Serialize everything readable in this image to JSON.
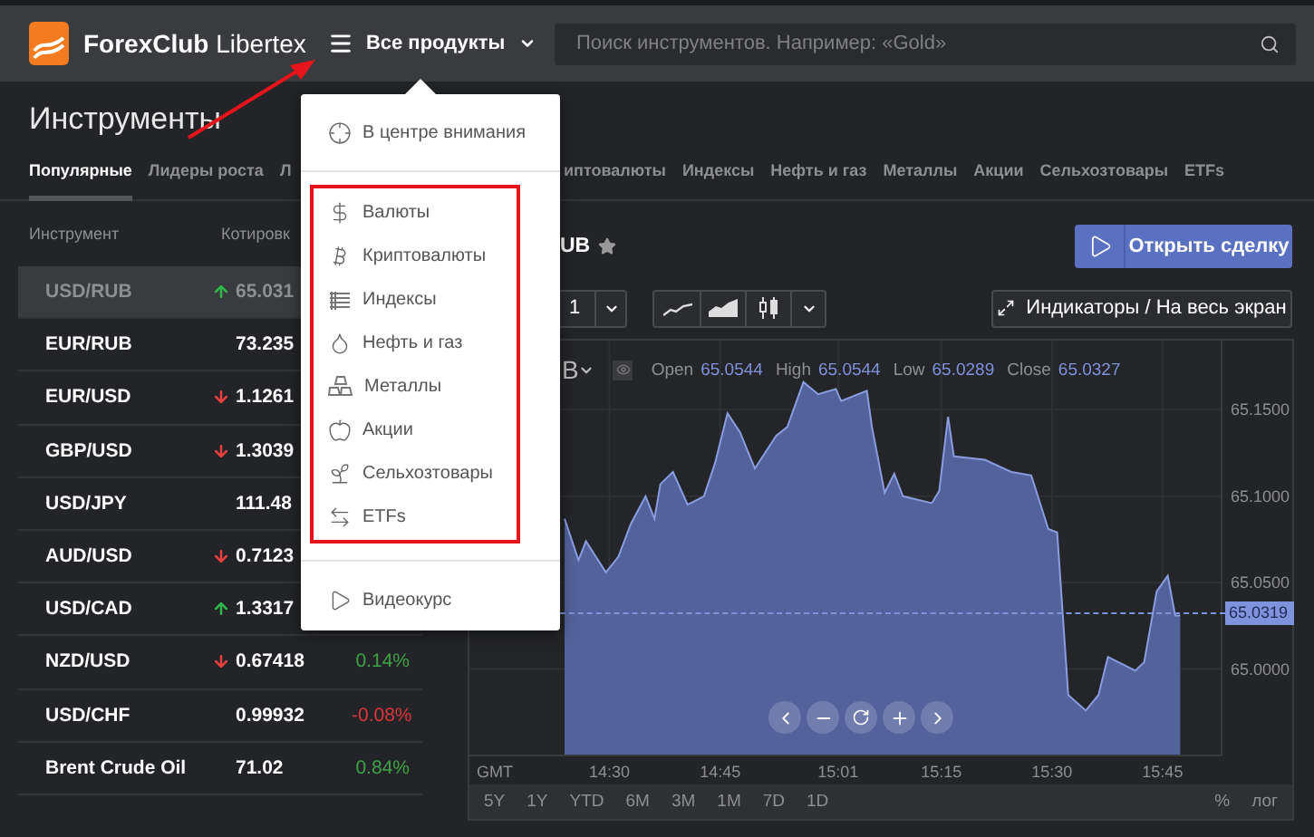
{
  "header": {
    "logo_text": "**ForexClub** Libertex",
    "menu_label": "Все продукты",
    "search": {
      "placeholder": "Поиск инструментов. Например: «Gold»"
    }
  },
  "page_title": "Инструменты",
  "tabs": {
    "before_menu": [
      {
        "label": "Популярные",
        "selected": true
      },
      {
        "label": "Лидеры роста",
        "selected": false
      },
      {
        "label": "Л",
        "selected": false
      }
    ],
    "after_menu": [
      {
        "label": "иптовалюты",
        "selected": false
      },
      {
        "label": "Индексы",
        "selected": false
      },
      {
        "label": "Нефть и газ",
        "selected": false
      },
      {
        "label": "Металлы",
        "selected": false
      },
      {
        "label": "Акции",
        "selected": false
      },
      {
        "label": "Сельхозтовары",
        "selected": false
      },
      {
        "label": "ETFs",
        "selected": false
      }
    ]
  },
  "instruments": {
    "columns": [
      "Инструмент",
      "Котировк"
    ],
    "rows": [
      {
        "name": "USD/RUB",
        "arrow_up": true,
        "quote": "65.031",
        "selected": true
      },
      {
        "name": "EUR/RUB",
        "quote": "73.235",
        "selected": false
      },
      {
        "name": "EUR/USD",
        "arrow_up": false,
        "quote": "1.1261",
        "selected": false
      },
      {
        "name": "GBP/USD",
        "arrow_up": false,
        "quote": "1.3039",
        "selected": false
      },
      {
        "name": "USD/JPY",
        "quote": "111.48",
        "selected": false
      },
      {
        "name": "AUD/USD",
        "arrow_up": false,
        "quote": "0.7123",
        "selected": false
      },
      {
        "name": "USD/CAD",
        "arrow_up": true,
        "quote": "1.3317",
        "selected": false
      },
      {
        "name": "NZD/USD",
        "arrow_up": false,
        "quote": "0.67418",
        "change": "0.14%",
        "change_positive": true,
        "selected": false
      },
      {
        "name": "USD/CHF",
        "quote": "0.99932",
        "change": "-0.08%",
        "change_positive": false,
        "selected": false
      },
      {
        "name": "Brent Crude Oil",
        "quote": "71.02",
        "change": "0.84%",
        "change_positive": true,
        "selected": false
      }
    ]
  },
  "chart_panel": {
    "symbol": "UB",
    "open_trade_button": "Открыть сделку",
    "interval": "1",
    "chart_types": [
      {
        "kind": "line"
      },
      {
        "kind": "area"
      },
      {
        "kind": "candles"
      }
    ],
    "indicators_button": "Индикаторы / На весь экран",
    "legend": {
      "symbol": "B",
      "items": [
        {
          "label": "Open",
          "value": "65.0544"
        },
        {
          "label": "High",
          "value": "65.0544"
        },
        {
          "label": "Low",
          "value": "65.0289"
        },
        {
          "label": "Close",
          "value": "65.0327"
        }
      ]
    },
    "last_price": "65.0319",
    "timezone": "GMT",
    "ranges": [
      "5Y",
      "1Y",
      "YTD",
      "6M",
      "3M",
      "1M",
      "7D",
      "1D"
    ],
    "scale_options": [
      "%",
      "лог"
    ],
    "chart_data": {
      "type": "area",
      "grid": true,
      "xlim": [
        851,
        953
      ],
      "ylim": [
        64.95,
        65.19
      ],
      "xticks": [
        {
          "value": 870,
          "label": "14:30"
        },
        {
          "value": 885,
          "label": "14:45"
        },
        {
          "value": 901,
          "label": "15:01"
        },
        {
          "value": 915,
          "label": "15:15"
        },
        {
          "value": 930,
          "label": "15:30"
        },
        {
          "value": 945,
          "label": "15:45"
        }
      ],
      "yticks": [
        {
          "value": 65.0,
          "label": "65.0000"
        },
        {
          "value": 65.05,
          "label": "65.0500"
        },
        {
          "value": 65.1,
          "label": "65.1000"
        },
        {
          "value": 65.15,
          "label": "65.1500"
        }
      ],
      "x": [
        863.9,
        865.8,
        866.8,
        869.5,
        871.2,
        872.9,
        874.9,
        876.1,
        876.9,
        878.6,
        880.6,
        882.8,
        884.3,
        886.0,
        887.7,
        889.7,
        892.6,
        894.1,
        896.3,
        898.3,
        900.7,
        901.4,
        904.9,
        905.6,
        907.3,
        908.6,
        909.8,
        913.7,
        914.7,
        915.9,
        916.7,
        920.9,
        924.5,
        927.2,
        929.5,
        930.7,
        932.2,
        934.6,
        936.3,
        937.6,
        941.3,
        942.5,
        944.2,
        945.7,
        946.7,
        947.4
      ],
      "series": [
        {
          "color": "#8a9de0",
          "values": [
            65.087,
            65.063,
            65.074,
            65.056,
            65.065,
            65.084,
            65.1,
            65.087,
            65.107,
            65.114,
            65.095,
            65.1,
            65.119,
            65.148,
            65.137,
            65.116,
            65.135,
            65.14,
            65.166,
            65.159,
            65.162,
            65.155,
            65.161,
            65.14,
            65.102,
            65.113,
            65.1,
            65.096,
            65.103,
            65.146,
            65.123,
            65.121,
            65.114,
            65.112,
            65.081,
            65.079,
            64.985,
            64.976,
            64.985,
            65.007,
            64.999,
            65.004,
            65.045,
            65.054,
            65.031,
            65.031
          ]
        }
      ]
    }
  },
  "menu": {
    "featured": "В центре внимания",
    "categories": [
      {
        "kind": "dollar",
        "label": "Валюты"
      },
      {
        "kind": "bitcoin",
        "label": "Криптовалюты"
      },
      {
        "kind": "index",
        "label": "Индексы"
      },
      {
        "kind": "drop",
        "label": "Нефть и газ"
      },
      {
        "kind": "bars",
        "label": "Металлы"
      },
      {
        "kind": "apple",
        "label": "Акции"
      },
      {
        "kind": "sprout",
        "label": "Сельхозтовары"
      },
      {
        "kind": "arrows",
        "label": "ETFs"
      }
    ],
    "footer_item": "Видеокурс"
  }
}
